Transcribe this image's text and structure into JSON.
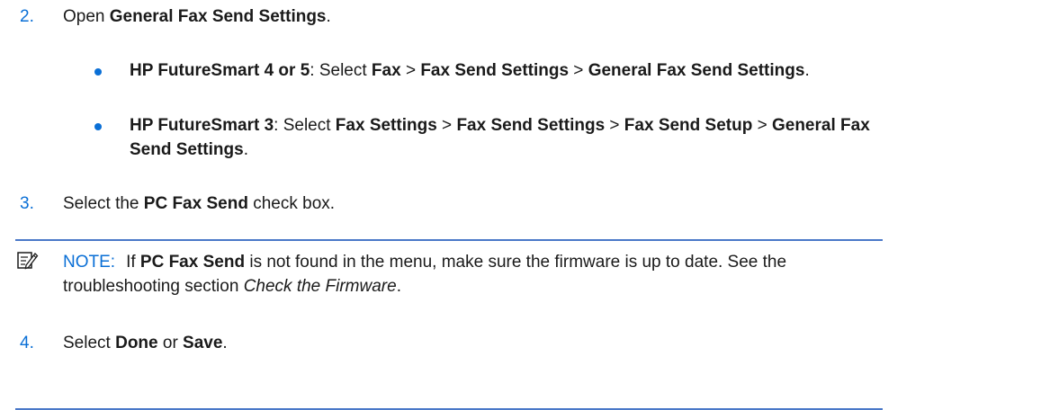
{
  "step2": {
    "num": "2.",
    "prefix": "Open ",
    "target": "General Fax Send Settings",
    "suffix": "."
  },
  "bullet1": {
    "product": "HP FutureSmart 4 or 5",
    "colon": ": Select ",
    "p1": "Fax",
    "sep1": " > ",
    "p2": "Fax Send Settings",
    "sep2": " > ",
    "p3": "General Fax Send Settings",
    "end": "."
  },
  "bullet2": {
    "product": "HP FutureSmart 3",
    "colon": ": Select ",
    "p1": "Fax Settings",
    "sep1": " > ",
    "p2": "Fax Send Settings",
    "sep2": " > ",
    "p3": "Fax Send Setup",
    "sep3": " > ",
    "p4": "General Fax Send Settings",
    "end": "."
  },
  "step3": {
    "num": "3.",
    "prefix": "Select the ",
    "target": "PC Fax Send",
    "suffix": " check box."
  },
  "note": {
    "icon": "note-pencil-icon",
    "label": "NOTE:",
    "pre": "If ",
    "strong": "PC Fax Send",
    "rest": " is not found in the menu, make sure the firmware is up to date. See the troubleshooting section ",
    "link": "Check the Firmware",
    "end": "."
  },
  "step4": {
    "num": "4.",
    "prefix": "Select ",
    "opt1": "Done",
    "mid": " or ",
    "opt2": "Save",
    "suffix": "."
  },
  "colors": {
    "accent": "#0a6fd6",
    "rule": "#4a78c8",
    "text": "#1a1a1a"
  }
}
